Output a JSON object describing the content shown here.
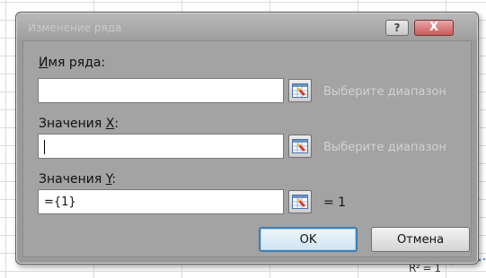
{
  "window": {
    "title": "Изменение ряда",
    "help_glyph": "?",
    "close_glyph": "X"
  },
  "fields": {
    "series_name": {
      "label_ul": "И",
      "label_rest": "мя ряда:",
      "value": "",
      "hint": "Выберите диапазон"
    },
    "x_values": {
      "label_pre": "Значения ",
      "label_ul": "X",
      "label_post": ":",
      "value": "",
      "hint": "Выберите диапазон"
    },
    "y_values": {
      "label_pre": "Значения ",
      "label_ul": "Y",
      "label_post": ":",
      "value": "={1}",
      "result": "= 1"
    }
  },
  "buttons": {
    "ok": "OK",
    "cancel": "Отмена"
  },
  "background": {
    "formula_text": "R² = 1"
  },
  "icons": {
    "range_selector": "collapse-dialog-icon"
  },
  "colors": {
    "dialog_bg": "#a3a3a3",
    "ok_border": "#3c7fb1",
    "close_red": "#c95a5a"
  }
}
